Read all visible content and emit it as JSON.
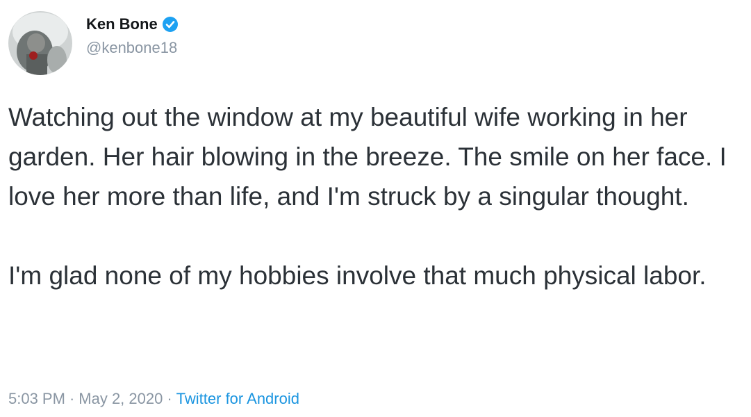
{
  "author": {
    "display_name": "Ken Bone",
    "handle": "@kenbone18",
    "verified": true
  },
  "tweet": {
    "paragraphs": [
      "Watching out the window at my beautiful wife working in her garden. Her hair blowing in the breeze. The smile on her face. I love her more than life, and I'm struck by a singular thought.",
      "I'm glad none of my hobbies involve that much physical labor."
    ]
  },
  "meta": {
    "time": "5:03 PM",
    "separator": "·",
    "date": "May 2, 2020",
    "source": "Twitter for Android"
  },
  "icons": {
    "verified_badge": "verified-badge-icon"
  },
  "colors": {
    "verified_blue": "#1da1f2",
    "link_blue": "#1b95e0",
    "muted_gray": "#8a96a3"
  }
}
